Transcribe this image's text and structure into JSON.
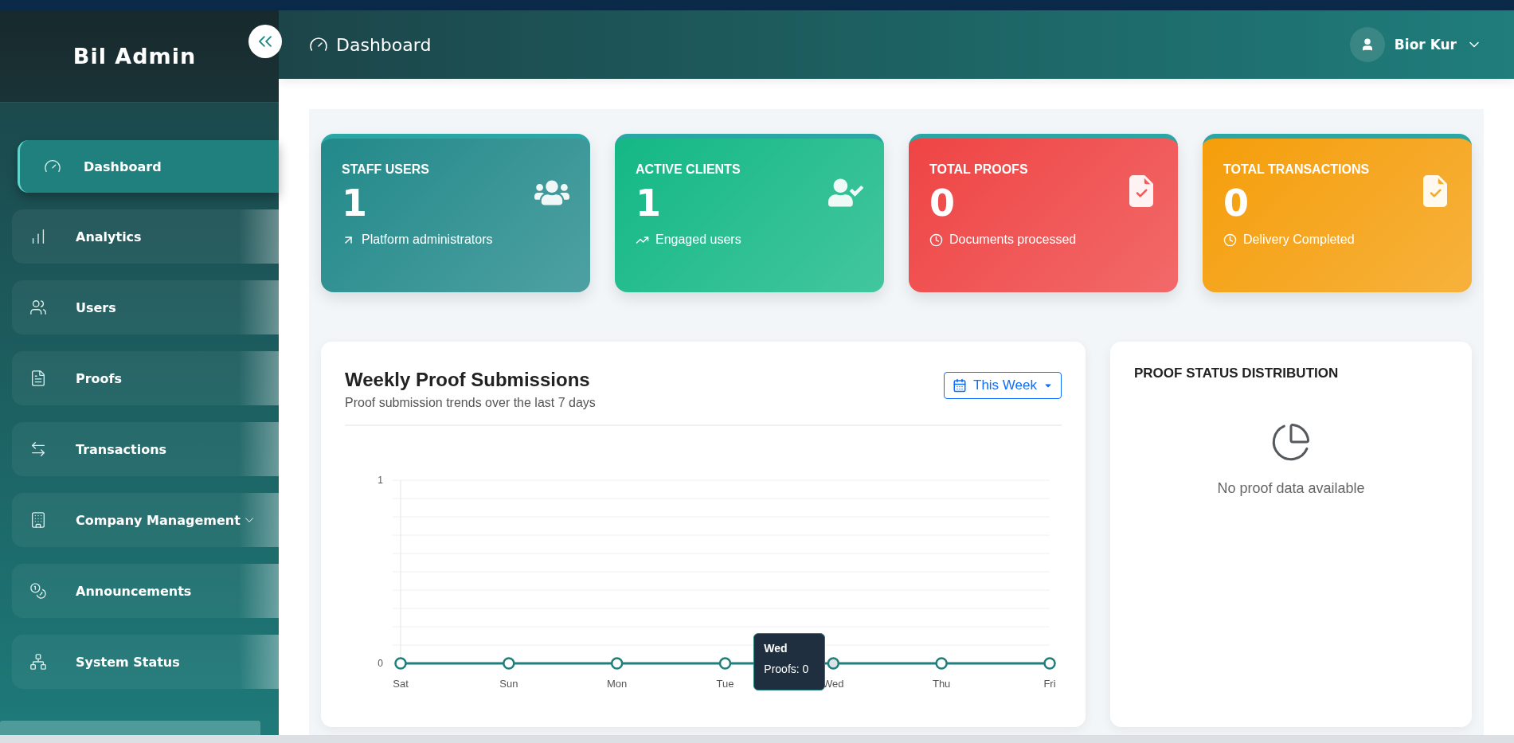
{
  "brand": "Bil Admin",
  "sidebar": {
    "items": [
      {
        "label": "Dashboard",
        "selected": true,
        "kind": "link"
      },
      {
        "label": "Analytics",
        "selected": false,
        "kind": "link"
      },
      {
        "label": "Users",
        "selected": false,
        "kind": "link"
      },
      {
        "label": "Proofs",
        "selected": false,
        "kind": "link"
      },
      {
        "label": "Transactions",
        "selected": false,
        "kind": "link"
      },
      {
        "label": "Company Management",
        "selected": false,
        "kind": "group"
      },
      {
        "label": "Announcements",
        "selected": false,
        "kind": "link"
      },
      {
        "label": "System Status",
        "selected": false,
        "kind": "link"
      }
    ]
  },
  "header": {
    "title": "Dashboard",
    "user": "Bior Kur"
  },
  "stats": [
    {
      "kind": "staff",
      "title": "STAFF USERS",
      "value": "1",
      "note": "Platform administrators",
      "color": "#22898a"
    },
    {
      "kind": "clients",
      "title": "ACTIVE CLIENTS",
      "value": "1",
      "note": "Engaged users",
      "color": "#14b885"
    },
    {
      "kind": "proofs",
      "title": "TOTAL PROOFS",
      "value": "0",
      "note": "Documents processed",
      "color": "#ef4444"
    },
    {
      "kind": "transactions",
      "title": "TOTAL TRANSACTIONS",
      "value": "0",
      "note": "Delivery Completed",
      "color": "#f59e0b"
    }
  ],
  "weekly": {
    "title": "Weekly Proof Submissions",
    "subtitle": "Proof submission trends over the last 7 days",
    "range": "This Week",
    "chart_data": {
      "type": "line",
      "categories": [
        "Sat",
        "Sun",
        "Mon",
        "Tue",
        "Wed",
        "Thu",
        "Fri"
      ],
      "series": [
        {
          "color": "#1f7f7c",
          "marker": "circle",
          "values": [
            0,
            0,
            0,
            0,
            0,
            0,
            0
          ]
        }
      ],
      "ylim": [
        0,
        1
      ],
      "yticks": [
        0,
        1
      ]
    },
    "points": [
      {
        "selected": false
      },
      {
        "selected": false
      },
      {
        "selected": false
      },
      {
        "selected": false
      },
      {
        "selected": true
      },
      {
        "selected": false
      },
      {
        "selected": false
      }
    ],
    "tooltip": {
      "title": "Wed",
      "text": "Proofs: 0"
    }
  },
  "distribution": {
    "title": "PROOF STATUS DISTRIBUTION",
    "empty": "No proof data available"
  }
}
